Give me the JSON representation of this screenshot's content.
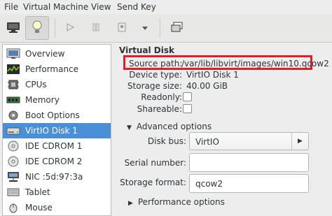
{
  "menubar": {
    "items": [
      "File",
      "Virtual Machine",
      "View",
      "Send Key"
    ]
  },
  "toolbar": {
    "buttons": [
      {
        "icon": "monitor-icon",
        "state": "normal"
      },
      {
        "icon": "lightbulb-icon",
        "state": "active"
      },
      {
        "icon": "play-icon",
        "state": "disabled"
      },
      {
        "icon": "pause-icon",
        "state": "disabled"
      },
      {
        "icon": "shutdown-icon",
        "state": "disabled"
      },
      {
        "icon": "chevron-down-icon",
        "state": "normal"
      },
      {
        "icon": "fullscreen-icon",
        "state": "normal"
      }
    ]
  },
  "sidebar": {
    "items": [
      {
        "label": "Overview",
        "icon": "overview-icon",
        "selected": false
      },
      {
        "label": "Performance",
        "icon": "performance-icon",
        "selected": false
      },
      {
        "label": "CPUs",
        "icon": "cpu-icon",
        "selected": false
      },
      {
        "label": "Memory",
        "icon": "memory-icon",
        "selected": false
      },
      {
        "label": "Boot Options",
        "icon": "boot-options-icon",
        "selected": false
      },
      {
        "label": "VirtIO Disk 1",
        "icon": "disk-icon",
        "selected": true
      },
      {
        "label": "IDE CDROM 1",
        "icon": "cdrom-icon",
        "selected": false
      },
      {
        "label": "IDE CDROM 2",
        "icon": "cdrom-icon",
        "selected": false
      },
      {
        "label": "NIC :5d:97:3a",
        "icon": "network-icon",
        "selected": false
      },
      {
        "label": "Tablet",
        "icon": "tablet-icon",
        "selected": false
      },
      {
        "label": "Mouse",
        "icon": "mouse-icon",
        "selected": false
      }
    ]
  },
  "main": {
    "title": "Virtual Disk",
    "source_path_label": "Source path:",
    "source_path_value": "/var/lib/libvirt/images/win10.qcow2",
    "device_type_label": "Device type:",
    "device_type_value": "VirtIO Disk 1",
    "storage_size_label": "Storage size:",
    "storage_size_value": "40.00 GiB",
    "readonly_label": "Readonly:",
    "readonly_checked": false,
    "shareable_label": "Shareable:",
    "shareable_checked": false,
    "advanced_options_label": "Advanced options",
    "disk_bus_label": "Disk bus:",
    "disk_bus_value": "VirtIO",
    "serial_number_label": "Serial number:",
    "serial_number_value": "",
    "storage_format_label": "Storage format:",
    "storage_format_value": "qcow2",
    "performance_options_label": "Performance options",
    "highlight_color": "#e41e26",
    "selection_color": "#4a90d9"
  }
}
